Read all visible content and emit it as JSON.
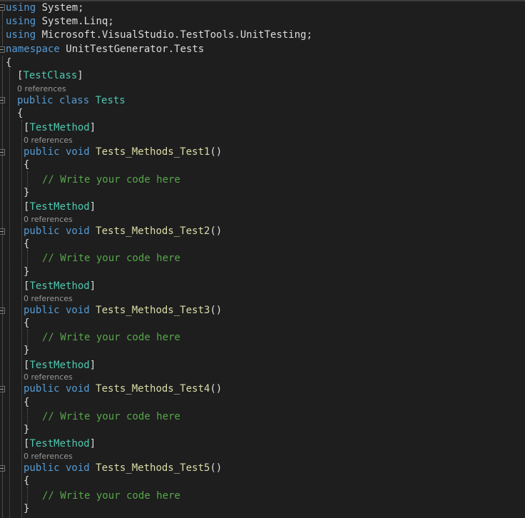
{
  "editor": {
    "usings": [
      {
        "keyword": "using",
        "name": "System;"
      },
      {
        "keyword": "using",
        "name": "System.Linq;"
      },
      {
        "keyword": "using",
        "name": "Microsoft.VisualStudio.TestTools.UnitTesting;"
      }
    ],
    "namespace_keyword": "namespace",
    "namespace_name": "UnitTestGenerator.Tests",
    "open_brace": "{",
    "close_brace": "}",
    "class_attribute": "TestClass",
    "class_references": "0 references",
    "class_modifiers": "public class",
    "class_name": "Tests",
    "method_attribute": "TestMethod",
    "method_modifiers": "public void",
    "comment": "// Write your code here",
    "methods": [
      {
        "references": "0 references",
        "name": "Tests_Methods_Test1",
        "params": "()"
      },
      {
        "references": "0 references",
        "name": "Tests_Methods_Test2",
        "params": "()"
      },
      {
        "references": "0 references",
        "name": "Tests_Methods_Test3",
        "params": "()"
      },
      {
        "references": "0 references",
        "name": "Tests_Methods_Test4",
        "params": "()"
      },
      {
        "references": "0 references",
        "name": "Tests_Methods_Test5",
        "params": "()"
      }
    ]
  },
  "colors": {
    "background": "#1e1e1e",
    "keyword": "#569cd6",
    "type": "#4ec9b0",
    "method": "#dcdcaa",
    "comment": "#57a64a",
    "text": "#dcdcdc",
    "codelens": "#999999"
  },
  "icons": [
    "fold-collapse-icon"
  ]
}
